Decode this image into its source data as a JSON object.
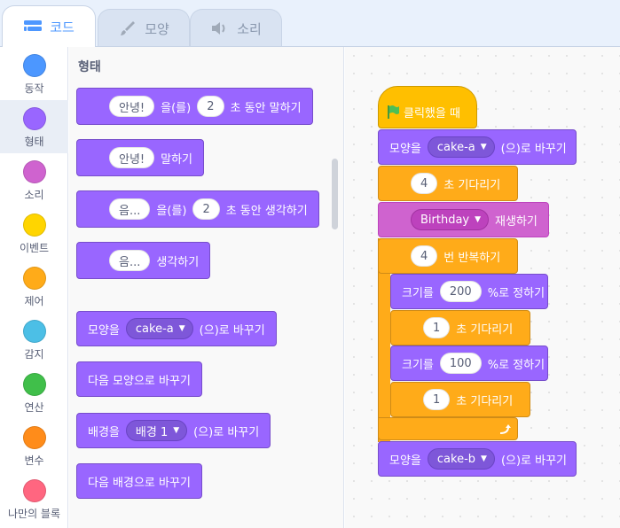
{
  "tabs": [
    {
      "label": "코드",
      "icon": "code-icon",
      "active": true
    },
    {
      "label": "모양",
      "icon": "brush-icon",
      "active": false
    },
    {
      "label": "소리",
      "icon": "speaker-icon",
      "active": false
    }
  ],
  "categories": [
    {
      "label": "동작",
      "color": "#4c97ff"
    },
    {
      "label": "형태",
      "color": "#9966ff"
    },
    {
      "label": "소리",
      "color": "#cf63cf"
    },
    {
      "label": "이벤트",
      "color": "#ffd500"
    },
    {
      "label": "제어",
      "color": "#ffab19"
    },
    {
      "label": "감지",
      "color": "#4cbfe6"
    },
    {
      "label": "연산",
      "color": "#40bf4a"
    },
    {
      "label": "변수",
      "color": "#ff8c1a"
    },
    {
      "label": "나만의 블록",
      "color": "#ff6680"
    }
  ],
  "palette": {
    "title": "형태",
    "say_for": {
      "msg": "안녕!",
      "mid": "을(를)",
      "secs": "2",
      "tail": "초 동안 말하기"
    },
    "say": {
      "msg": "안녕!",
      "tail": "말하기"
    },
    "think_for": {
      "msg": "음...",
      "mid": "을(를)",
      "secs": "2",
      "tail": "초 동안 생각하기"
    },
    "think": {
      "msg": "음...",
      "tail": "생각하기"
    },
    "switch_costume": {
      "head": "모양을",
      "value": "cake-a",
      "tail": "(으)로 바꾸기"
    },
    "next_costume": {
      "label": "다음 모양으로 바꾸기"
    },
    "switch_backdrop": {
      "head": "배경을",
      "value": "배경 1",
      "tail": "(으)로 바꾸기"
    },
    "next_backdrop": {
      "label": "다음 배경으로 바꾸기"
    }
  },
  "script": {
    "hat": "클릭했을 때",
    "costume1": {
      "head": "모양을",
      "value": "cake-a",
      "tail": "(으)로 바꾸기"
    },
    "wait1": {
      "value": "4",
      "tail": "초 기다리기"
    },
    "sound": {
      "value": "Birthday",
      "tail": "재생하기"
    },
    "repeat": {
      "value": "4",
      "tail": "번 반복하기"
    },
    "size1": {
      "head": "크기를",
      "value": "200",
      "tail": "%로 정하기"
    },
    "wait2": {
      "value": "1",
      "tail": "초 기다리기"
    },
    "size2": {
      "head": "크기를",
      "value": "100",
      "tail": "%로 정하기"
    },
    "wait3": {
      "value": "1",
      "tail": "초 기다리기"
    },
    "costume2": {
      "head": "모양을",
      "value": "cake-b",
      "tail": "(으)로 바꾸기"
    }
  }
}
